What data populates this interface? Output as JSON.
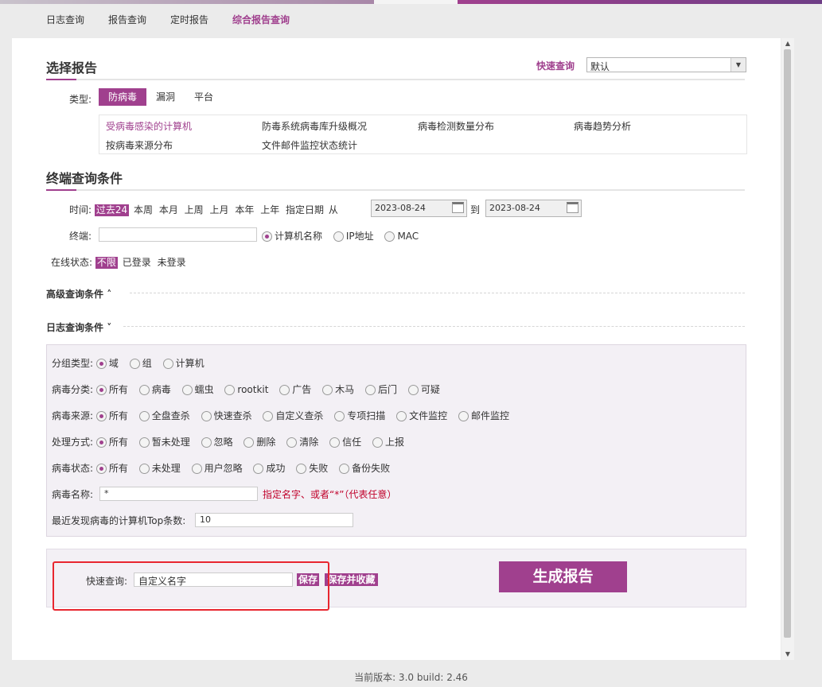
{
  "colors": {
    "accent": "#a0408e",
    "hint_red": "#c0002a",
    "highlight_box": "#e8262f"
  },
  "nav": {
    "items": [
      {
        "label": "日志查询"
      },
      {
        "label": "报告查询"
      },
      {
        "label": "定时报告"
      },
      {
        "label": "综合报告查询",
        "active": true
      }
    ]
  },
  "select_report": {
    "title": "选择报告",
    "quick_query_label": "快速查询",
    "quick_query_value": "默认",
    "type_label": "类型:",
    "types": [
      "防病毒",
      "漏洞",
      "平台"
    ],
    "active_type": "防病毒",
    "reports": [
      "受病毒感染的计算机",
      "防毒系统病毒库升级概况",
      "病毒检测数量分布",
      "病毒趋势分析",
      "按病毒来源分布",
      "文件邮件监控状态统计"
    ],
    "active_report": "受病毒感染的计算机"
  },
  "terminal": {
    "title": "终端查询条件",
    "time_label": "时间:",
    "time_options": [
      "过去24",
      "本周",
      "本月",
      "上周",
      "上月",
      "本年",
      "上年",
      "指定日期"
    ],
    "active_time": "过去24",
    "from_label": "从",
    "to_label": "到",
    "date_from": "2023-08-24",
    "date_to": "2023-08-24",
    "terminal_label": "终端:",
    "terminal_value": "",
    "terminal_options": [
      "计算机名称",
      "IP地址",
      "MAC"
    ],
    "terminal_selected": "计算机名称",
    "online_label": "在线状态:",
    "online_options": [
      "不限",
      "已登录",
      "未登录"
    ],
    "online_active": "不限"
  },
  "advanced": {
    "label": "高级查询条件",
    "icon": "chevron-up-icon"
  },
  "log": {
    "label": "日志查询条件",
    "icon": "chevron-down-icon",
    "group_type_label": "分组类型:",
    "group_type_options": [
      "域",
      "组",
      "计算机"
    ],
    "virus_class_label": "病毒分类:",
    "virus_class_options": [
      "所有",
      "病毒",
      "蠕虫",
      "rootkit",
      "广告",
      "木马",
      "后门",
      "可疑"
    ],
    "virus_source_label": "病毒来源:",
    "virus_source_options": [
      "所有",
      "全盘查杀",
      "快速查杀",
      "自定义查杀",
      "专项扫描",
      "文件监控",
      "邮件监控"
    ],
    "handling_label": "处理方式:",
    "handling_options": [
      "所有",
      "暂未处理",
      "忽略",
      "删除",
      "清除",
      "信任",
      "上报"
    ],
    "virus_state_label": "病毒状态:",
    "virus_state_options": [
      "所有",
      "未处理",
      "用户忽略",
      "成功",
      "失败",
      "备份失败"
    ],
    "virus_name_label": "病毒名称:",
    "virus_name_value": "*",
    "virus_name_hint": "指定名字、或者“*”（代表任意）",
    "topn_label": "最近发现病毒的计算机Top条数:",
    "topn_value": "10"
  },
  "quick": {
    "label": "快速查询:",
    "name_value": "自定义名字",
    "save_label": "保存",
    "save_fav_label": "保存并收藏",
    "generate_label": "生成报告"
  },
  "footer": {
    "text": "当前版本: 3.0    build: 2.46"
  }
}
